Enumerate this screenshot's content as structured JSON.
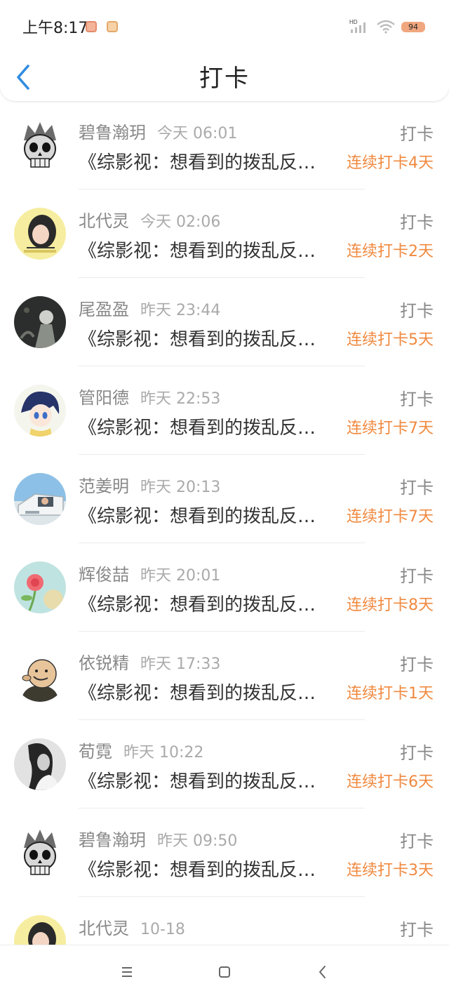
{
  "status_bar": {
    "time": "上午8:17",
    "signal_label": "HD",
    "battery": "94",
    "icons": [
      "app-notification-icon",
      "app-notification-icon",
      "signal-icon",
      "wifi-icon",
      "battery-icon"
    ]
  },
  "header": {
    "title": "打卡",
    "back_icon": "chevron-left-icon"
  },
  "colors": {
    "accent": "#f0893f",
    "back_arrow": "#2f8ce0",
    "muted_text": "#888888",
    "body_text": "#333333"
  },
  "feed": [
    {
      "user": "碧鲁瀚玥",
      "time": "今天 06:01",
      "tag": "打卡",
      "content": "《综影视：想看到的拨乱反正》",
      "streak": "连续打卡4天",
      "avatar": "skull-avatar"
    },
    {
      "user": "北代灵",
      "time": "今天 02:06",
      "tag": "打卡",
      "content": "《综影视：想看到的拨乱反正》",
      "streak": "连续打卡2天",
      "avatar": "girl-avatar"
    },
    {
      "user": "尾盈盈",
      "time": "昨天 23:44",
      "tag": "打卡",
      "content": "《综影视：想看到的拨乱反正》",
      "streak": "连续打卡5天",
      "avatar": "dark-art-avatar"
    },
    {
      "user": "管阳德",
      "time": "昨天 22:53",
      "tag": "打卡",
      "content": "《综影视：想看到的拨乱反正》",
      "streak": "连续打卡7天",
      "avatar": "anime-avatar"
    },
    {
      "user": "范姜明",
      "time": "昨天 20:13",
      "tag": "打卡",
      "content": "《综影视：想看到的拨乱反正》",
      "streak": "连续打卡7天",
      "avatar": "car-avatar"
    },
    {
      "user": "辉俊喆",
      "time": "昨天 20:01",
      "tag": "打卡",
      "content": "《综影视：想看到的拨乱反正》",
      "streak": "连续打卡8天",
      "avatar": "flower-avatar"
    },
    {
      "user": "依锐精",
      "time": "昨天 17:33",
      "tag": "打卡",
      "content": "《综影视：想看到的拨乱反正》",
      "streak": "连续打卡1天",
      "avatar": "cartoon-man-avatar"
    },
    {
      "user": "荀霓",
      "time": "昨天 10:22",
      "tag": "打卡",
      "content": "《综影视：想看到的拨乱反正》",
      "streak": "连续打卡6天",
      "avatar": "bw-girl-avatar"
    },
    {
      "user": "碧鲁瀚玥",
      "time": "昨天 09:50",
      "tag": "打卡",
      "content": "《综影视：想看到的拨乱反正》",
      "streak": "连续打卡3天",
      "avatar": "skull-avatar"
    },
    {
      "user": "北代灵",
      "time": "10-18",
      "tag": "打卡",
      "content": "",
      "streak": "",
      "avatar": "girl-avatar"
    }
  ],
  "bottom_nav": {
    "icons": [
      "menu-icon",
      "home-icon",
      "back-icon"
    ]
  }
}
